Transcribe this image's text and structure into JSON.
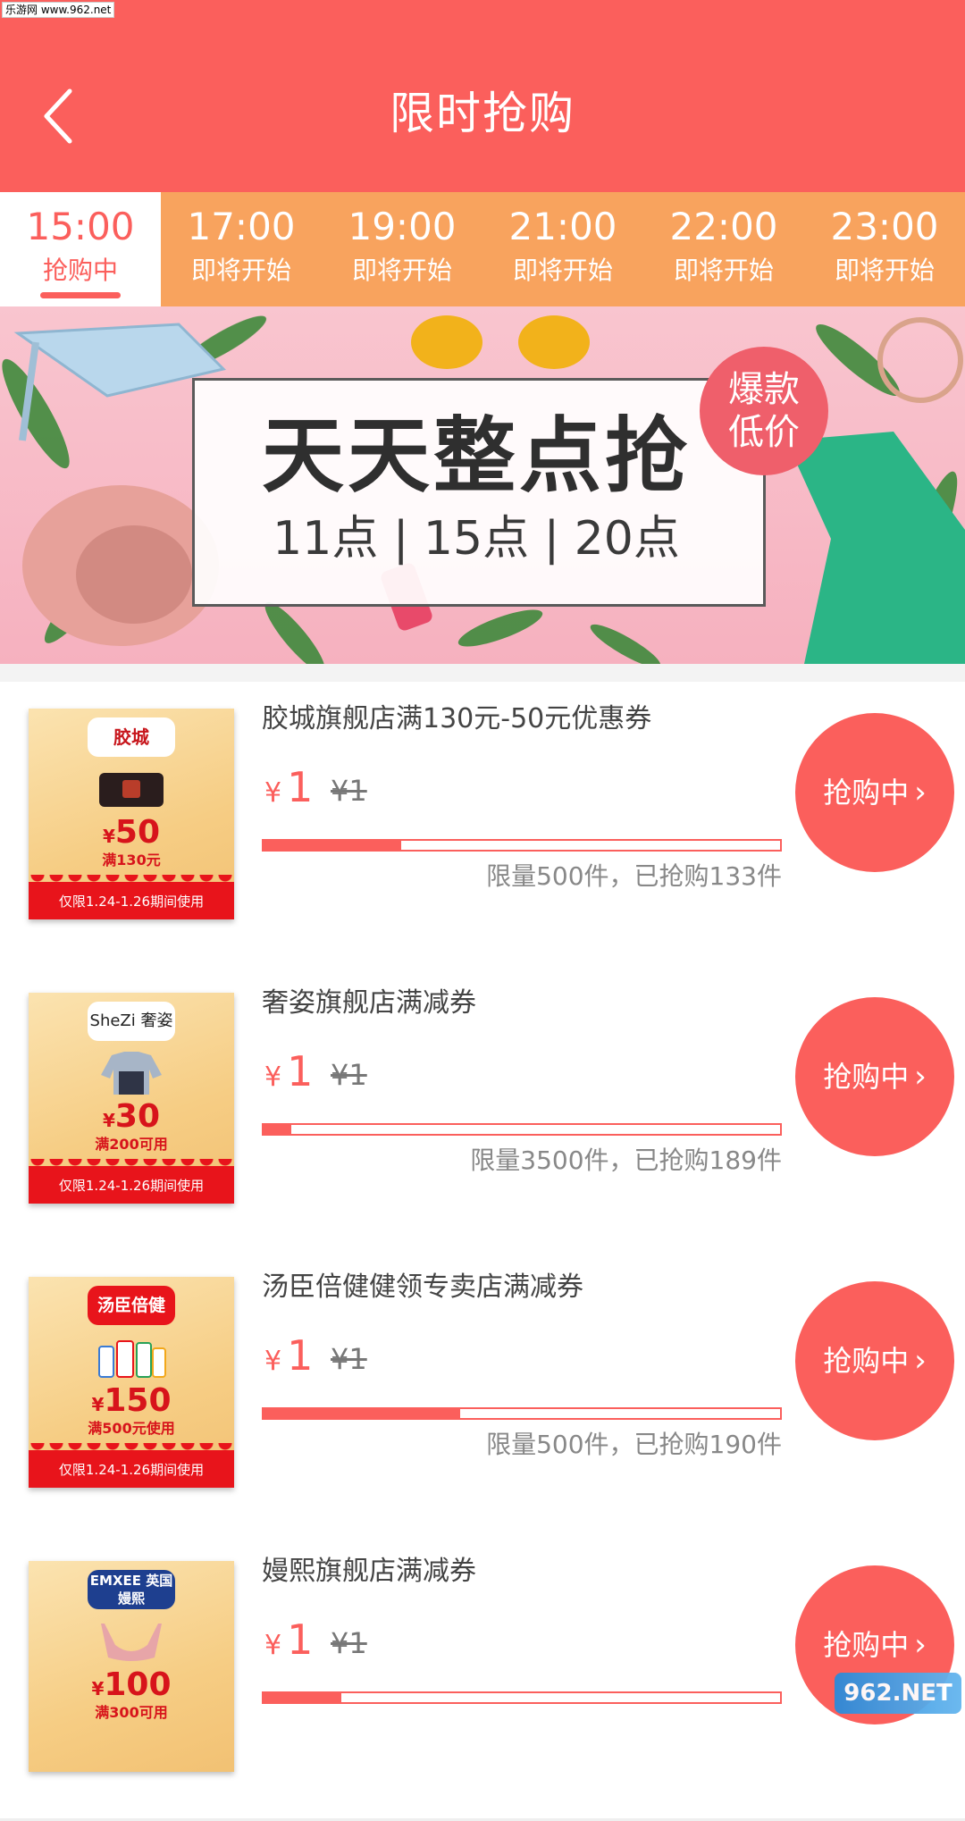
{
  "watermark_top": "乐游网 www.962.net",
  "header": {
    "title": "限时抢购"
  },
  "tabs": [
    {
      "time": "15:00",
      "status": "抢购中",
      "active": true
    },
    {
      "time": "17:00",
      "status": "即将开始",
      "active": false
    },
    {
      "time": "19:00",
      "status": "即将开始",
      "active": false
    },
    {
      "time": "21:00",
      "status": "即将开始",
      "active": false
    },
    {
      "time": "22:00",
      "status": "即将开始",
      "active": false
    },
    {
      "time": "23:00",
      "status": "即将开始",
      "active": false
    }
  ],
  "banner": {
    "title": "天天整点抢",
    "times": "11点 | 15点 | 20点",
    "badge_line1": "爆款",
    "badge_line2": "低价"
  },
  "items": [
    {
      "title": "胶城旗舰店满130元-50元优惠券",
      "price_now": "1",
      "price_old": "¥1",
      "progress": 0.266,
      "stock_text": "限量500件，已抢购133件",
      "button_label": "抢购中",
      "coupon": {
        "logo": "胶城",
        "yen": "¥",
        "amount": "50",
        "condition": "满130元",
        "footer": "仅限1.24-1.26期间使用"
      }
    },
    {
      "title": "奢姿旗舰店满减券",
      "price_now": "1",
      "price_old": "¥1",
      "progress": 0.054,
      "stock_text": "限量3500件，已抢购189件",
      "button_label": "抢购中",
      "coupon": {
        "logo": "SheZi 奢姿",
        "yen": "¥",
        "amount": "30",
        "condition": "满200可用",
        "footer": "仅限1.24-1.26期间使用"
      }
    },
    {
      "title": "汤臣倍健健领专卖店满减券",
      "price_now": "1",
      "price_old": "¥1",
      "progress": 0.38,
      "stock_text": "限量500件，已抢购190件",
      "button_label": "抢购中",
      "coupon": {
        "logo": "汤臣倍健",
        "yen": "¥",
        "amount": "150",
        "condition": "满500元使用",
        "footer": "仅限1.24-1.26期间使用"
      }
    },
    {
      "title": "嫚熙旗舰店满减券",
      "price_now": "1",
      "price_old": "¥1",
      "progress": 0.15,
      "stock_text": "",
      "button_label": "抢购中",
      "coupon": {
        "logo": "EMXEE 英国嫚熙",
        "yen": "¥",
        "amount": "100",
        "condition": "满300可用",
        "footer": ""
      }
    }
  ],
  "currency_symbol": "¥",
  "watermark_bottom": "962.NET",
  "colors": {
    "primary": "#fb5f5c",
    "tab_bar": "#f8a35e",
    "coupon_red": "#e8141b"
  }
}
